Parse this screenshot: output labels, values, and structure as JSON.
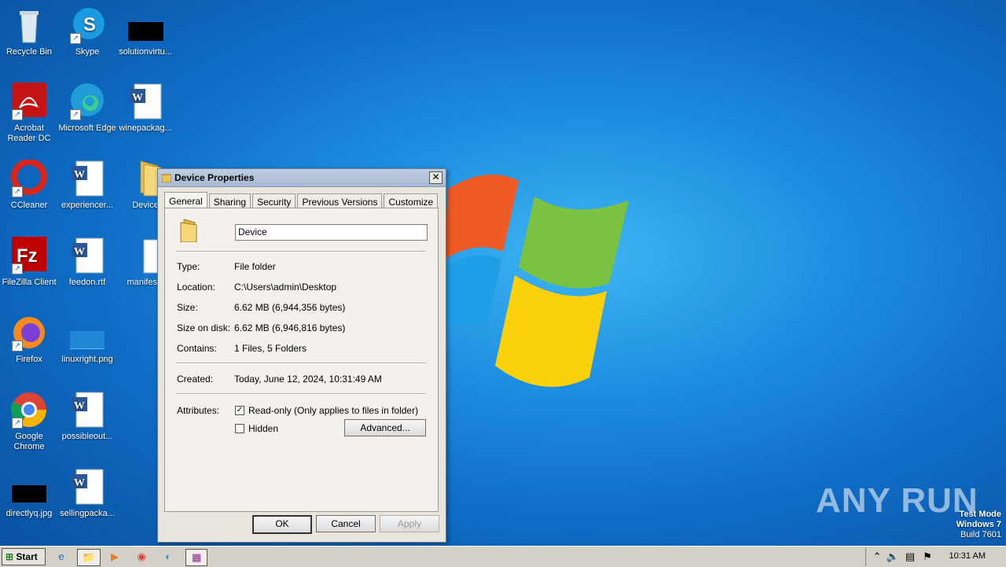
{
  "desktop": {
    "icons": [
      {
        "label": "Recycle Bin"
      },
      {
        "label": "Skype"
      },
      {
        "label": "solutionvirtu..."
      },
      {
        "label": "Acrobat Reader DC"
      },
      {
        "label": "Microsoft Edge"
      },
      {
        "label": "winepackag..."
      },
      {
        "label": "CCleaner"
      },
      {
        "label": "experiencer..."
      },
      {
        "label": "Device"
      },
      {
        "label": "FileZilla Client"
      },
      {
        "label": "feedon.rtf"
      },
      {
        "label": "manifest.j"
      },
      {
        "label": "Firefox"
      },
      {
        "label": "linuxright.png"
      },
      {
        "label": "Google Chrome"
      },
      {
        "label": "possibleout..."
      },
      {
        "label": "directlyq.jpg"
      },
      {
        "label": "sellingpacka..."
      }
    ]
  },
  "dialog": {
    "title": "Device Properties",
    "close_label": "✕",
    "tabs": [
      {
        "label": "General"
      },
      {
        "label": "Sharing"
      },
      {
        "label": "Security"
      },
      {
        "label": "Previous Versions"
      },
      {
        "label": "Customize"
      }
    ],
    "name_value": "Device",
    "fields": {
      "type_label": "Type:",
      "type_value": "File folder",
      "location_label": "Location:",
      "location_value": "C:\\Users\\admin\\Desktop",
      "size_label": "Size:",
      "size_value": "6.62 MB (6,944,356 bytes)",
      "size_on_disk_label": "Size on disk:",
      "size_on_disk_value": "6.62 MB (6,946,816 bytes)",
      "contains_label": "Contains:",
      "contains_value": "1 Files, 5 Folders",
      "created_label": "Created:",
      "created_value": "Today, June 12, 2024, 10:31:49 AM",
      "attributes_label": "Attributes:",
      "readonly_label": "Read-only (Only applies to files in folder)",
      "readonly_checked": true,
      "hidden_label": "Hidden",
      "hidden_checked": false,
      "advanced_label": "Advanced..."
    },
    "buttons": {
      "ok": "OK",
      "cancel": "Cancel",
      "apply": "Apply"
    }
  },
  "taskbar": {
    "start_label": "Start",
    "clock": "10:31 AM"
  },
  "watermark": "ANY RUN",
  "testmode": {
    "line1": "Test Mode",
    "line2": "Windows 7",
    "line3": "Build 7601"
  }
}
